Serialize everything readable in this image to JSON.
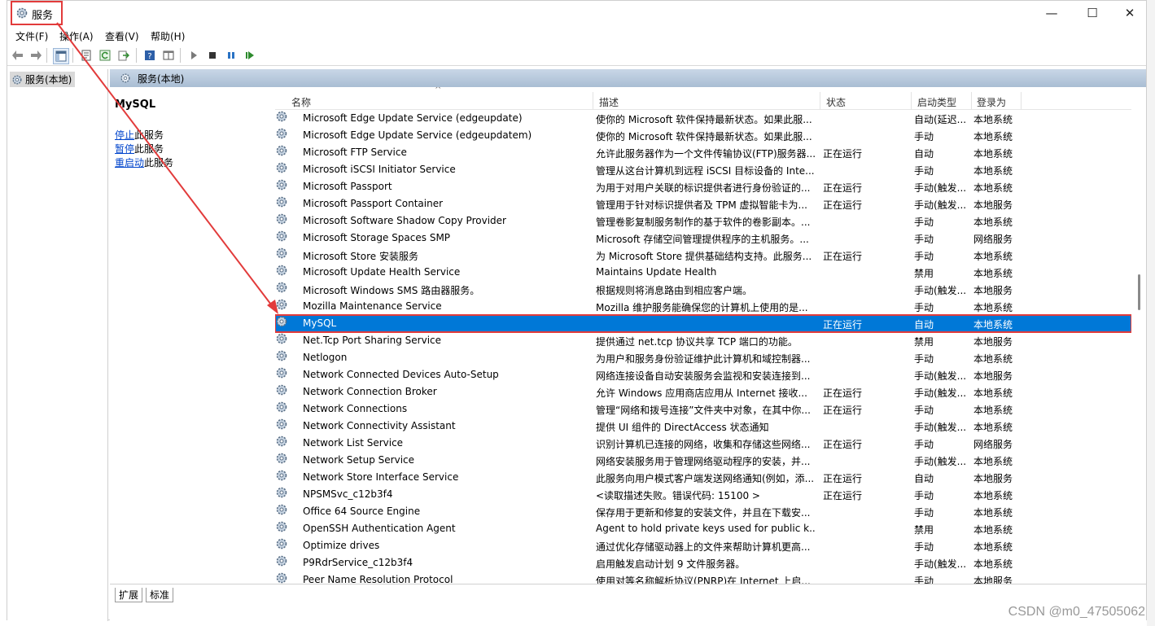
{
  "window": {
    "title": "服务",
    "min": "—",
    "max": "☐",
    "close": "✕"
  },
  "menu": [
    "文件(F)",
    "操作(A)",
    "查看(V)",
    "帮助(H)"
  ],
  "tree": {
    "node": "服务(本地)"
  },
  "pane": {
    "header": "服务(本地)",
    "selected_title": "MySQL",
    "actions": [
      {
        "link": "停止",
        "rest": "此服务"
      },
      {
        "link": "暂停",
        "rest": "此服务"
      },
      {
        "link": "重启动",
        "rest": "此服务"
      }
    ]
  },
  "columns": {
    "name": "名称",
    "desc": "描述",
    "status": "状态",
    "startup": "启动类型",
    "logon": "登录为"
  },
  "rows": [
    {
      "name": "Microsoft Edge Update Service (edgeupdate)",
      "desc": "使你的 Microsoft 软件保持最新状态。如果此服...",
      "status": "",
      "startup": "自动(延迟...",
      "logon": "本地系统"
    },
    {
      "name": "Microsoft Edge Update Service (edgeupdatem)",
      "desc": "使你的 Microsoft 软件保持最新状态。如果此服...",
      "status": "",
      "startup": "手动",
      "logon": "本地系统"
    },
    {
      "name": "Microsoft FTP Service",
      "desc": "允许此服务器作为一个文件传输协议(FTP)服务器...",
      "status": "正在运行",
      "startup": "自动",
      "logon": "本地系统"
    },
    {
      "name": "Microsoft iSCSI Initiator Service",
      "desc": "管理从这台计算机到远程 iSCSI 目标设备的 Inte...",
      "status": "",
      "startup": "手动",
      "logon": "本地系统"
    },
    {
      "name": "Microsoft Passport",
      "desc": "为用于对用户关联的标识提供者进行身份验证的...",
      "status": "正在运行",
      "startup": "手动(触发...",
      "logon": "本地系统"
    },
    {
      "name": "Microsoft Passport Container",
      "desc": "管理用于针对标识提供者及 TPM 虚拟智能卡为...",
      "status": "正在运行",
      "startup": "手动(触发...",
      "logon": "本地服务"
    },
    {
      "name": "Microsoft Software Shadow Copy Provider",
      "desc": "管理卷影复制服务制作的基于软件的卷影副本。...",
      "status": "",
      "startup": "手动",
      "logon": "本地系统"
    },
    {
      "name": "Microsoft Storage Spaces SMP",
      "desc": "Microsoft 存储空间管理提供程序的主机服务。...",
      "status": "",
      "startup": "手动",
      "logon": "网络服务"
    },
    {
      "name": "Microsoft Store 安装服务",
      "desc": "为 Microsoft Store 提供基础结构支持。此服务...",
      "status": "正在运行",
      "startup": "手动",
      "logon": "本地系统"
    },
    {
      "name": "Microsoft Update Health Service",
      "desc": "Maintains Update Health",
      "status": "",
      "startup": "禁用",
      "logon": "本地系统"
    },
    {
      "name": "Microsoft Windows SMS 路由器服务。",
      "desc": "根据规则将消息路由到相应客户端。",
      "status": "",
      "startup": "手动(触发...",
      "logon": "本地服务"
    },
    {
      "name": "Mozilla Maintenance Service",
      "desc": "Mozilla 维护服务能确保您的计算机上使用的是...",
      "status": "",
      "startup": "手动",
      "logon": "本地系统"
    },
    {
      "name": "MySQL",
      "desc": "",
      "status": "正在运行",
      "startup": "自动",
      "logon": "本地系统",
      "selected": true
    },
    {
      "name": "Net.Tcp Port Sharing Service",
      "desc": "提供通过 net.tcp 协议共享 TCP 端口的功能。",
      "status": "",
      "startup": "禁用",
      "logon": "本地服务"
    },
    {
      "name": "Netlogon",
      "desc": "为用户和服务身份验证维护此计算机和域控制器...",
      "status": "",
      "startup": "手动",
      "logon": "本地系统"
    },
    {
      "name": "Network Connected Devices Auto-Setup",
      "desc": "网络连接设备自动安装服务会监视和安装连接到...",
      "status": "",
      "startup": "手动(触发...",
      "logon": "本地服务"
    },
    {
      "name": "Network Connection Broker",
      "desc": "允许 Windows 应用商店应用从 Internet 接收...",
      "status": "正在运行",
      "startup": "手动(触发...",
      "logon": "本地系统"
    },
    {
      "name": "Network Connections",
      "desc": "管理“网络和拨号连接”文件夹中对象，在其中你...",
      "status": "正在运行",
      "startup": "手动",
      "logon": "本地系统"
    },
    {
      "name": "Network Connectivity Assistant",
      "desc": "提供 UI 组件的 DirectAccess 状态通知",
      "status": "",
      "startup": "手动(触发...",
      "logon": "本地系统"
    },
    {
      "name": "Network List Service",
      "desc": "识别计算机已连接的网络，收集和存储这些网络...",
      "status": "正在运行",
      "startup": "手动",
      "logon": "网络服务"
    },
    {
      "name": "Network Setup Service",
      "desc": "网络安装服务用于管理网络驱动程序的安装，并...",
      "status": "",
      "startup": "手动(触发...",
      "logon": "本地系统"
    },
    {
      "name": "Network Store Interface Service",
      "desc": "此服务向用户模式客户端发送网络通知(例如，添...",
      "status": "正在运行",
      "startup": "自动",
      "logon": "本地服务"
    },
    {
      "name": "NPSMSvc_c12b3f4",
      "desc": "<读取描述失败。错误代码: 15100 >",
      "status": "正在运行",
      "startup": "手动",
      "logon": "本地系统"
    },
    {
      "name": "Office 64 Source Engine",
      "desc": "保存用于更新和修复的安装文件，并且在下载安...",
      "status": "",
      "startup": "手动",
      "logon": "本地系统"
    },
    {
      "name": "OpenSSH Authentication Agent",
      "desc": "Agent to hold private keys used for public k...",
      "status": "",
      "startup": "禁用",
      "logon": "本地系统"
    },
    {
      "name": "Optimize drives",
      "desc": "通过优化存储驱动器上的文件来帮助计算机更高...",
      "status": "",
      "startup": "手动",
      "logon": "本地系统"
    },
    {
      "name": "P9RdrService_c12b3f4",
      "desc": "启用触发启动计划 9 文件服务器。",
      "status": "",
      "startup": "手动(触发...",
      "logon": "本地系统"
    },
    {
      "name": "Peer Name Resolution Protocol",
      "desc": "使用对等名称解析协议(PNRP)在 Internet 上启...",
      "status": "",
      "startup": "手动",
      "logon": "本地服务"
    }
  ],
  "tabs": [
    "扩展",
    "标准"
  ],
  "watermark": "CSDN @m0_47505062",
  "colors": {
    "selection": "#0078d7",
    "annotation": "#e23b3b",
    "header": "#b4c6da"
  }
}
